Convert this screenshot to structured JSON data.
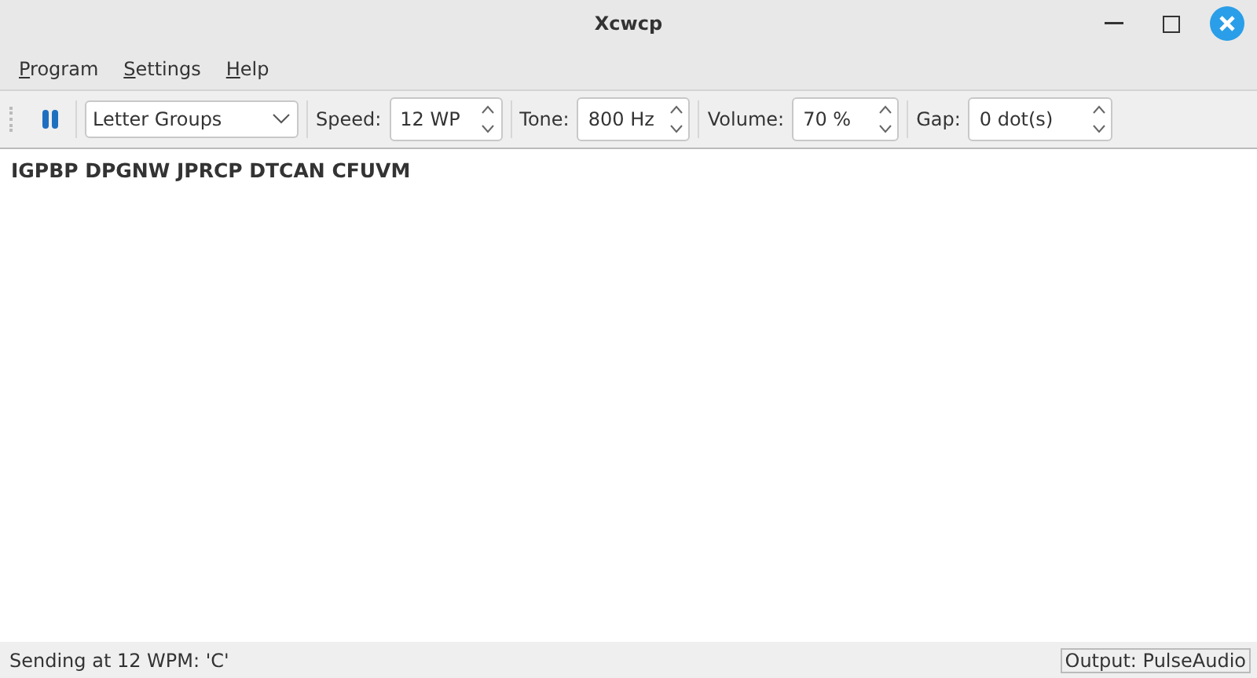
{
  "window": {
    "title": "Xcwcp"
  },
  "menu": [
    "Program",
    "Settings",
    "Help"
  ],
  "toolbar": {
    "mode": "Letter Groups",
    "spinners": [
      {
        "label": "Speed:",
        "value": "12 WP"
      },
      {
        "label": "Tone:",
        "value": "800 Hz"
      },
      {
        "label": "Volume:",
        "value": "70 %"
      },
      {
        "label": "Gap:",
        "value": "0 dot(s)"
      }
    ]
  },
  "text": "IGPBP DPGNW JPRCP DTCAN CFUVM",
  "status_bar": {
    "message": "Sending at 12 WPM: 'C'",
    "output": "Output: PulseAudio"
  }
}
